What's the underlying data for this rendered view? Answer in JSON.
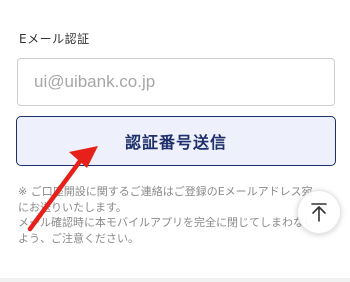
{
  "email_section": {
    "label": "Eメール認証",
    "input_placeholder": "ui@uibank.co.jp",
    "input_value": ""
  },
  "send_button": {
    "label": "認証番号送信"
  },
  "notes": {
    "line1": "※ ご口座開設に関するご連絡はご登録のEメールアドレス宛にお送りいたします。",
    "line2": "メール確認時に本モバイルアプリを完全に閉じてしまわないよう、ご注意ください。"
  },
  "icons": {
    "scroll_top": "arrow-up-icon",
    "annotation": "red-arrow-icon"
  },
  "colors": {
    "button_border": "#1e2f6e",
    "button_bg": "#eef1fb",
    "annotation_arrow": "#e8201a"
  }
}
